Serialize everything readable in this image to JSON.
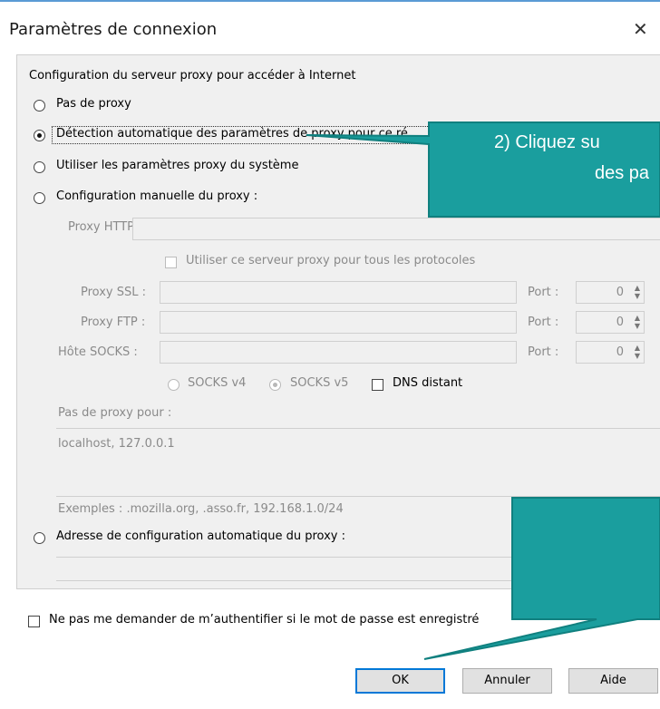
{
  "dialog": {
    "title": "Paramètres de connexion",
    "close_glyph": "✕"
  },
  "proxy_group": {
    "heading": "Configuration du serveur proxy pour accéder à Internet",
    "options": [
      {
        "label": "Pas de proxy",
        "selected": false
      },
      {
        "label": "Détection automatique des paramètres de proxy pour ce ré",
        "selected": true
      },
      {
        "label": "Utiliser les paramètres proxy du système",
        "selected": false
      },
      {
        "label": "Configuration manuelle du proxy :",
        "selected": false
      }
    ],
    "manual": {
      "http_label": "Proxy HTTP :",
      "use_all_label": "Utiliser ce serveur proxy pour tous les protocoles",
      "ssl_label": "Proxy SSL :",
      "ftp_label": "Proxy FTP :",
      "socks_label": "Hôte SOCKS :",
      "port_label": "Port :",
      "port_values": [
        "0",
        "0",
        "0"
      ],
      "socks_v4": "SOCKS v4",
      "socks_v5": "SOCKS v5",
      "dns_label": "DNS distant",
      "no_proxy_label": "Pas de proxy pour :",
      "no_proxy_value": "localhost, 127.0.0.1",
      "examples": "Exemples : .mozilla.org, .asso.fr, 192.168.1.0/24"
    },
    "autoconfig_label": "Adresse de configuration automatique du proxy :"
  },
  "auth_checkbox_label": "Ne pas me demander de m’authentifier si le mot de passe est enregistré",
  "buttons": {
    "ok": "OK",
    "cancel": "Annuler",
    "help": "Aide"
  },
  "callouts": {
    "first_line": "2)   Cliquez su",
    "second_line": "des pa",
    "color": "#1a9e9e"
  }
}
